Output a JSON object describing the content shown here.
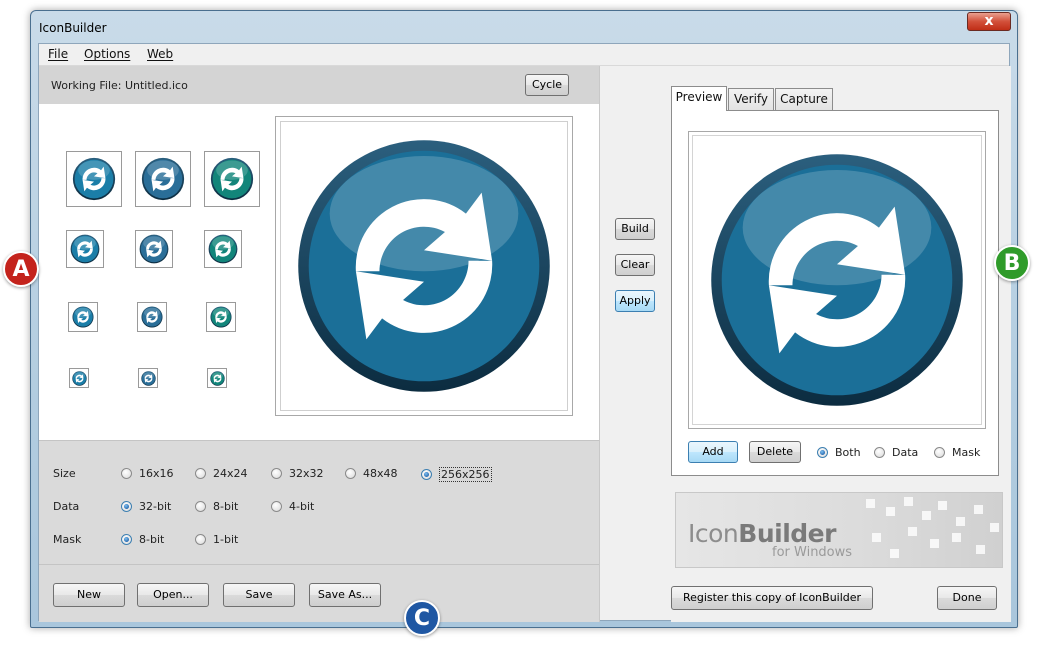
{
  "window": {
    "title": "IconBuilder",
    "close_label": "x"
  },
  "menu": [
    {
      "label": "File"
    },
    {
      "label": "Options"
    },
    {
      "label": "Web"
    }
  ],
  "left": {
    "working_file_label": "Working File:  Untitled.ico",
    "cycle_label": "Cycle",
    "size_label": "Size",
    "size_options": [
      "16x16",
      "24x24",
      "32x32",
      "48x48",
      "256x256"
    ],
    "size_selected": "256x256",
    "data_label": "Data",
    "data_options": [
      "32-bit",
      "8-bit",
      "4-bit"
    ],
    "data_selected": "32-bit",
    "mask_label": "Mask",
    "mask_options": [
      "8-bit",
      "1-bit"
    ],
    "mask_selected": "8-bit",
    "buttons": {
      "new": "New",
      "open": "Open...",
      "save": "Save",
      "save_as": "Save As..."
    }
  },
  "middle": {
    "build": "Build",
    "clear": "Clear",
    "apply": "Apply"
  },
  "right": {
    "tabs": [
      "Preview",
      "Verify",
      "Capture"
    ],
    "active_tab": "Preview",
    "add": "Add",
    "delete": "Delete",
    "view_options": [
      "Both",
      "Data",
      "Mask"
    ],
    "view_selected": "Both",
    "brand_light": "Icon",
    "brand_bold": "Builder",
    "brand_sub": "for Windows",
    "register": "Register this copy of IconBuilder",
    "done": "Done"
  },
  "callouts": [
    {
      "label": "A",
      "color": "#c4231c"
    },
    {
      "label": "B",
      "color": "#2f9b2a"
    },
    {
      "label": "C",
      "color": "#1f57a3"
    }
  ],
  "colors": {
    "icon_blue": "#1d6f95",
    "icon_teal": "#12857a",
    "arrow": "#ffffff"
  },
  "icons": {
    "refresh": "refresh-sync-icon"
  }
}
